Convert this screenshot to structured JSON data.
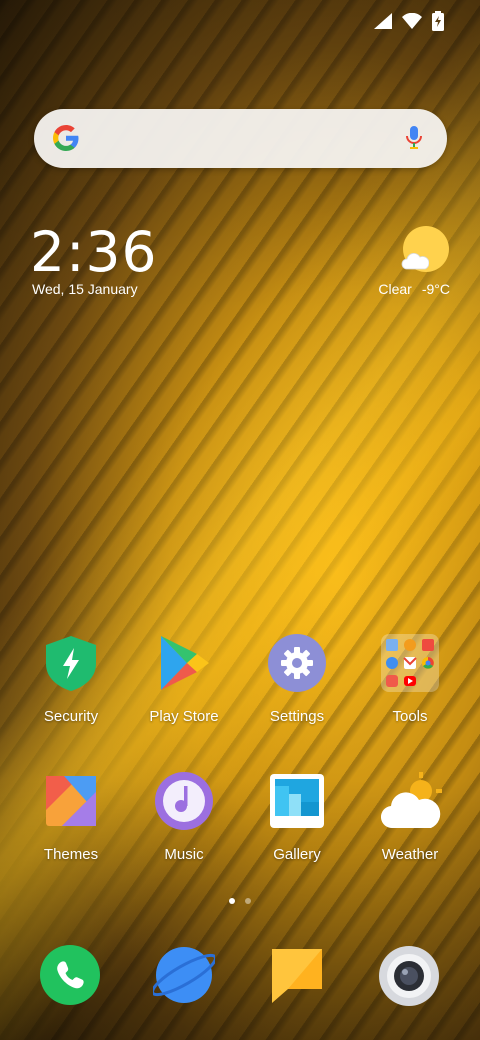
{
  "status_bar": {
    "icons": [
      "signal-icon",
      "wifi-icon",
      "battery-charging-icon"
    ]
  },
  "search": {
    "logo": "google-g-icon",
    "mic": "microphone-icon"
  },
  "clock_widget": {
    "time": "2:36",
    "date": "Wed, 15 January"
  },
  "weather_widget": {
    "icon": "partly-sunny-icon",
    "condition": "Clear",
    "temperature": "-9°C"
  },
  "apps_row1": [
    {
      "label": "Security",
      "icon": "shield-icon"
    },
    {
      "label": "Play Store",
      "icon": "play-store-icon"
    },
    {
      "label": "Settings",
      "icon": "gear-icon"
    },
    {
      "label": "Tools",
      "icon": "folder-icon"
    }
  ],
  "apps_row2": [
    {
      "label": "Themes",
      "icon": "themes-icon"
    },
    {
      "label": "Music",
      "icon": "music-icon"
    },
    {
      "label": "Gallery",
      "icon": "gallery-icon"
    },
    {
      "label": "Weather",
      "icon": "weather-icon"
    }
  ],
  "page_indicator": {
    "pages": 2,
    "current": 1
  },
  "dock": [
    "phone-icon",
    "browser-icon",
    "messages-icon",
    "camera-icon"
  ],
  "colors": {
    "security_green": "#1fbb6f",
    "phone_green": "#21c25e",
    "browser_blue": "#3d8ef5",
    "messages_yellow": "#ffc53d",
    "settings_purple": "#8d8fd6",
    "music_purple": "#9c6fe0"
  }
}
